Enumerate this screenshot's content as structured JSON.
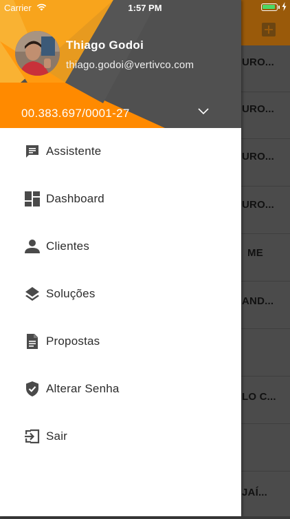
{
  "status_bar": {
    "carrier": "Carrier",
    "time": "1:57 PM"
  },
  "drawer": {
    "user": {
      "name": "Thiago Godoi",
      "email": "thiago.godoi@vertivco.com"
    },
    "account": {
      "id": "00.383.697/0001-27"
    },
    "colors": {
      "accent": "#ff8a00",
      "header_dark": "#505050",
      "icon": "#4a4a4a"
    },
    "menu": [
      {
        "label": "Assistente",
        "icon": "chat-icon"
      },
      {
        "label": "Dashboard",
        "icon": "dashboard-icon"
      },
      {
        "label": "Clientes",
        "icon": "person-icon"
      },
      {
        "label": "Soluções",
        "icon": "layers-icon"
      },
      {
        "label": "Propostas",
        "icon": "document-icon"
      },
      {
        "label": "Alterar Senha",
        "icon": "shield-check-icon"
      },
      {
        "label": "Sair",
        "icon": "exit-icon"
      }
    ]
  },
  "background_list": [
    "URO...",
    "URO...",
    "URO...",
    "URO...",
    "ME",
    "AND...",
    "",
    "LO C...",
    "",
    "JAÍ..."
  ]
}
